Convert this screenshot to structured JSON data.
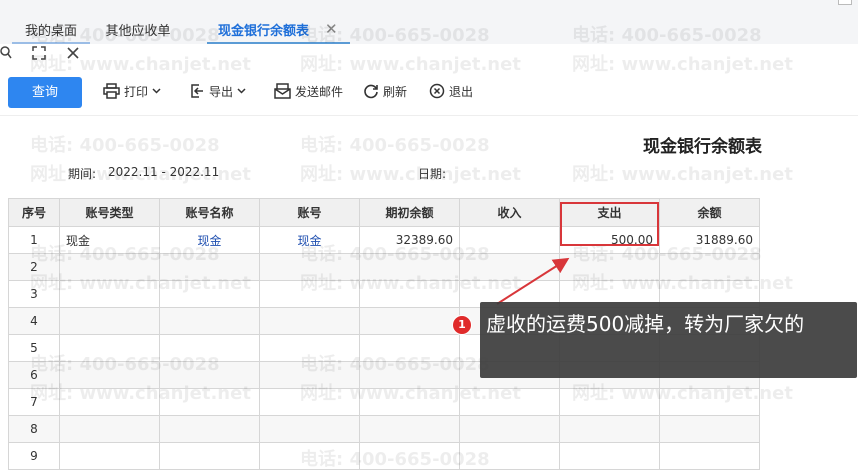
{
  "tabs": [
    {
      "label": "我的桌面",
      "active": false
    },
    {
      "label": "其他应收单",
      "active": false
    },
    {
      "label": "现金银行余额表",
      "active": true
    }
  ],
  "toolbar": {
    "query": "查询",
    "print": "打印",
    "export": "导出",
    "email": "发送邮件",
    "refresh": "刷新",
    "exit": "退出"
  },
  "report": {
    "title": "现金银行余额表",
    "period_label": "期间:",
    "period_value": "2022.11 - 2022.11",
    "date_label": "日期:"
  },
  "table": {
    "headers": [
      "序号",
      "账号类型",
      "账号名称",
      "账号",
      "期初余额",
      "收入",
      "支出",
      "余额"
    ],
    "rows": [
      [
        "1",
        "现金",
        "现金",
        "现金",
        "32389.60",
        "",
        "500.00",
        "31889.60"
      ],
      [
        "2",
        "",
        "",
        "",
        "",
        "",
        "",
        ""
      ],
      [
        "3",
        "",
        "",
        "",
        "",
        "",
        "",
        ""
      ],
      [
        "4",
        "",
        "",
        "",
        "",
        "",
        "",
        ""
      ],
      [
        "5",
        "",
        "",
        "",
        "",
        "",
        "",
        ""
      ],
      [
        "6",
        "",
        "",
        "",
        "",
        "",
        "",
        ""
      ],
      [
        "7",
        "",
        "",
        "",
        "",
        "",
        "",
        ""
      ],
      [
        "8",
        "",
        "",
        "",
        "",
        "",
        "",
        ""
      ],
      [
        "9",
        "",
        "",
        "",
        "",
        "",
        "",
        ""
      ]
    ]
  },
  "annotation": {
    "marker": "1",
    "text": "虚收的运费500减掉，转为厂家欠的"
  },
  "watermark": {
    "phone": "电话: 400-665-0028",
    "site": "网址: www.chanjet.net"
  },
  "colors": {
    "accent": "#2e86f0",
    "highlight": "#d8363a",
    "link": "#1f4fb0"
  }
}
